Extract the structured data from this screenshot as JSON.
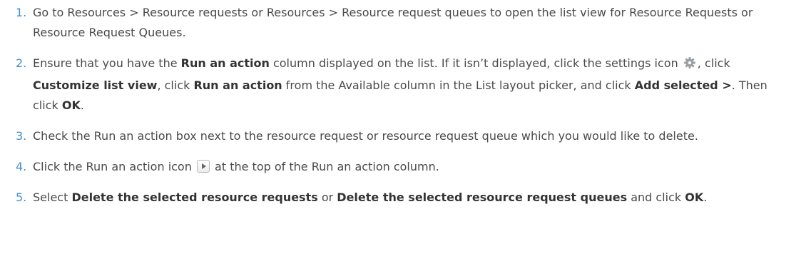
{
  "steps": [
    {
      "number": "1.",
      "segments": [
        {
          "text": "Go to Resources > Resource requests or Resources > Resource request queues to open the list view for Resource Requests or Resource Request Queues."
        }
      ]
    },
    {
      "number": "2.",
      "segments": [
        {
          "text": "Ensure that you have the "
        },
        {
          "text": "Run an action",
          "bold": true
        },
        {
          "text": " column displayed on the list. If it isn’t displayed, click the settings icon "
        },
        {
          "icon": "gear-icon"
        },
        {
          "text": ", click "
        },
        {
          "text": "Customize list view",
          "bold": true
        },
        {
          "text": ", click "
        },
        {
          "text": "Run an action",
          "bold": true
        },
        {
          "text": " from the Available column in the List layout picker, and click "
        },
        {
          "text": "Add selected >",
          "bold": true
        },
        {
          "text": ". Then click "
        },
        {
          "text": "OK",
          "bold": true
        },
        {
          "text": "."
        }
      ]
    },
    {
      "number": "3.",
      "segments": [
        {
          "text": "Check the Run an action box next to the resource request or resource request queue which you would like to delete."
        }
      ]
    },
    {
      "number": "4.",
      "segments": [
        {
          "text": "Click the Run an action icon "
        },
        {
          "icon": "run-action-icon"
        },
        {
          "text": " at the top of the Run an action column."
        }
      ]
    },
    {
      "number": "5.",
      "segments": [
        {
          "text": "Select "
        },
        {
          "text": "Delete the selected resource requests",
          "bold": true
        },
        {
          "text": " or "
        },
        {
          "text": "Delete the selected resource request queues",
          "bold": true
        },
        {
          "text": " and click "
        },
        {
          "text": "OK",
          "bold": true
        },
        {
          "text": "."
        }
      ]
    }
  ],
  "colors": {
    "step_number": "#3d8fd0",
    "body_text": "#4a4a4a",
    "bold_text": "#333333",
    "gear": "#9aa0a6"
  }
}
